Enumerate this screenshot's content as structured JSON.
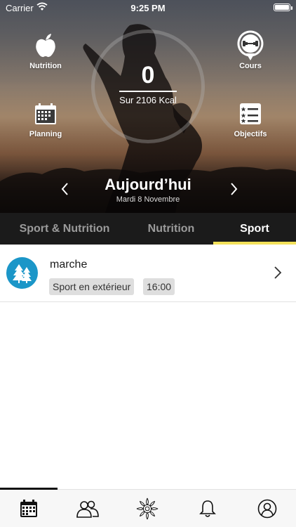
{
  "status_bar": {
    "carrier": "Carrier",
    "time": "9:25 PM"
  },
  "shortcuts": {
    "nutrition": {
      "label": "Nutrition",
      "icon": "apple-icon"
    },
    "cours": {
      "label": "Cours",
      "icon": "dumbbell-icon"
    },
    "planning": {
      "label": "Planning",
      "icon": "calendar-icon"
    },
    "objectifs": {
      "label": "Objectifs",
      "icon": "checklist-icon"
    }
  },
  "calories": {
    "value": "0",
    "goal_text": "Sur 2106 Kcal",
    "progress": 0
  },
  "day_nav": {
    "title": "Aujourd’hui",
    "date": "Mardi 8 Novembre"
  },
  "tabs": [
    {
      "label": "Sport & Nutrition",
      "active": false
    },
    {
      "label": "Nutrition",
      "active": false
    },
    {
      "label": "Sport",
      "active": true
    }
  ],
  "activities": [
    {
      "name": "marche",
      "category": "Sport en extérieur",
      "time": "16:00",
      "icon": "trees-icon"
    }
  ],
  "tab_bar": [
    {
      "name": "calendar-tab",
      "active": true
    },
    {
      "name": "community-tab",
      "active": false
    },
    {
      "name": "flower-tab",
      "active": false
    },
    {
      "name": "notifications-tab",
      "active": false
    },
    {
      "name": "profile-tab",
      "active": false
    }
  ],
  "colors": {
    "accent": "#f3e15a",
    "tab_bg": "#1b1b1b",
    "activity_icon_bg": "#1b96c8"
  }
}
